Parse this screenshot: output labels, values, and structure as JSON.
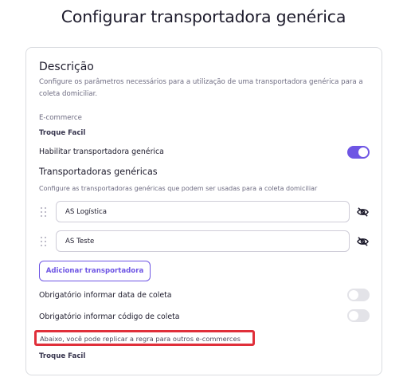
{
  "page": {
    "title": "Configurar transportadora genérica"
  },
  "card": {
    "section_title": "Descrição",
    "section_description": "Configure os parâmetros necessários para a utilização de uma transportadora genérica para a coleta domiciliar.",
    "ecommerce_label": "E-commerce",
    "ecommerce_value": "Troque Facil",
    "enable_label": "Habilitar transportadora genérica",
    "enable_toggle_on": true,
    "carriers_title": "Transportadoras genéricas",
    "carriers_description": "Configure as transportadoras genéricas que podem ser usadas para a coleta domiciliar",
    "carriers": [
      {
        "value": "AS Logística",
        "visibility_icon": "eye-off-icon"
      },
      {
        "value": "AS Teste",
        "visibility_icon": "eye-off-icon"
      }
    ],
    "add_button_label": "Adicionar transportadora",
    "require_date_label": "Obrigatório informar data de coleta",
    "require_date_on": false,
    "require_code_label": "Obrigatório informar código de coleta",
    "require_code_on": false,
    "replicate_note": "Abaixo, você pode replicar a regra para outros e-commerces",
    "replicate_ecommerce": "Troque Facil"
  },
  "colors": {
    "accent": "#6e55e4",
    "highlight_border": "#e02f3a",
    "toggle_off": "#e3e3e8"
  }
}
